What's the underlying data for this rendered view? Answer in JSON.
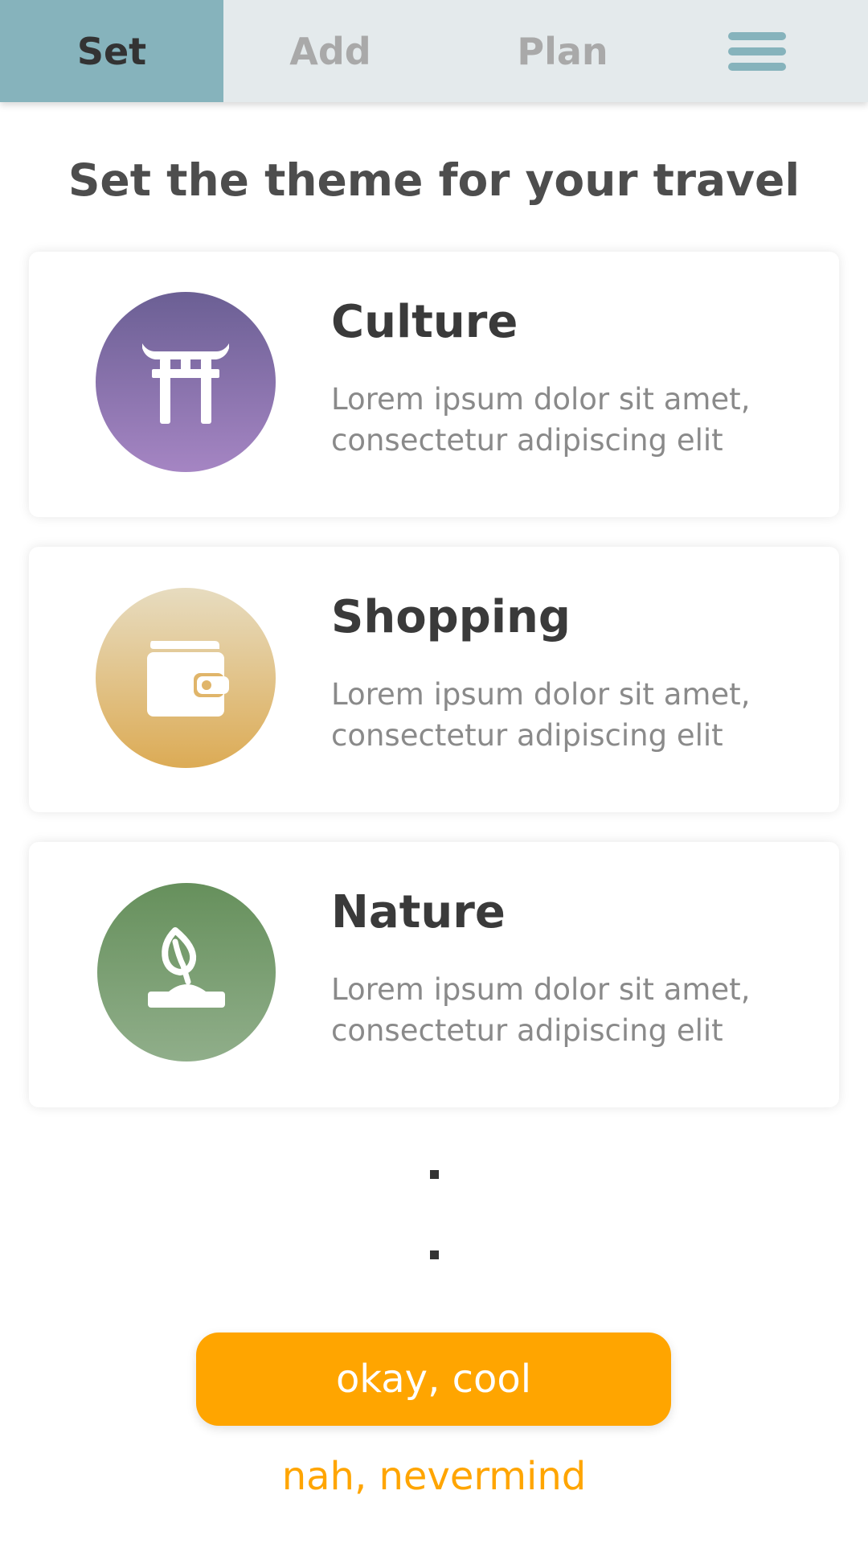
{
  "tabs": [
    {
      "label": "Set",
      "active": true
    },
    {
      "label": "Add",
      "active": false
    },
    {
      "label": "Plan",
      "active": false
    }
  ],
  "menu_icon": "hamburger-menu-icon",
  "heading": "Set the theme for your travel",
  "themes": [
    {
      "title": "Culture",
      "description": "Lorem ipsum dolor sit amet, consectetur adipiscing elit",
      "icon": "torii-gate-icon",
      "color": "#8a73b0"
    },
    {
      "title": "Shopping",
      "description": "Lorem ipsum dolor sit amet, consectetur adipiscing elit",
      "icon": "wallet-icon",
      "color": "#dfbc7a"
    },
    {
      "title": "Nature",
      "description": "Lorem ipsum dolor sit amet, consectetur adipiscing elit",
      "icon": "sprout-icon",
      "color": "#789f70"
    }
  ],
  "actions": {
    "confirm_label": "okay, cool",
    "cancel_label": "nah, nevermind"
  },
  "colors": {
    "accent": "#ffa500",
    "active_tab": "#86b3bc",
    "tabbar_bg": "#e4eaec"
  }
}
